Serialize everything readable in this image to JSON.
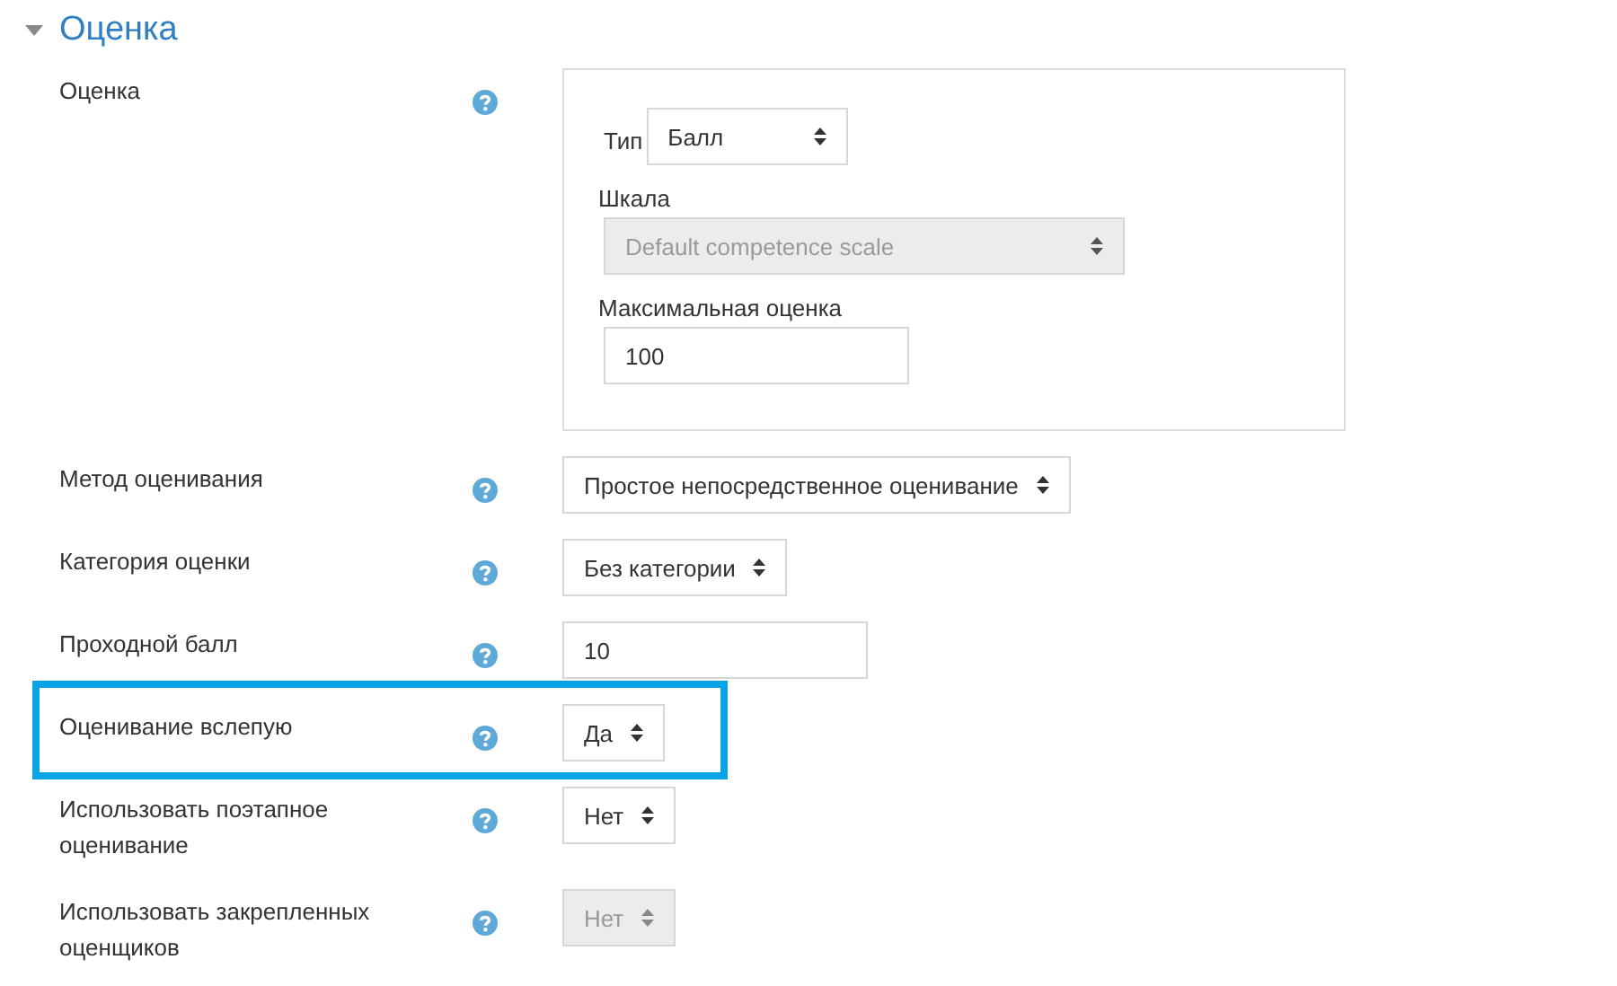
{
  "section": {
    "title": "Оценка",
    "expanded": true
  },
  "rows": [
    {
      "kind": "fieldset",
      "label": "Оценка",
      "type_label": "Тип",
      "type_value": "Балл",
      "scale_label": "Шкала",
      "scale_value": "Default competence scale",
      "scale_disabled": true,
      "max_label": "Максимальная оценка",
      "max_value": "100"
    },
    {
      "kind": "select",
      "label": "Метод оценивания",
      "value": "Простое непосредственное оценивание",
      "disabled": false,
      "highlighted": false
    },
    {
      "kind": "select",
      "label": "Категория оценки",
      "value": "Без категории",
      "disabled": false,
      "highlighted": false
    },
    {
      "kind": "input",
      "label": "Проходной балл",
      "value": "10",
      "disabled": false,
      "highlighted": false
    },
    {
      "kind": "select",
      "label": "Оценивание вслепую",
      "value": "Да",
      "disabled": false,
      "highlighted": true
    },
    {
      "kind": "select",
      "label": "Использовать поэтапное оценивание",
      "value": "Нет",
      "disabled": false,
      "highlighted": false
    },
    {
      "kind": "select",
      "label": "Использовать закрепленных оценщиков",
      "value": "Нет",
      "disabled": true,
      "highlighted": false
    }
  ]
}
